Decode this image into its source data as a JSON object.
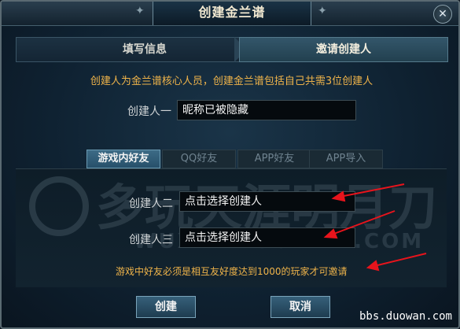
{
  "dialog": {
    "title": "创建金兰谱",
    "close_icon": "close-icon"
  },
  "steps": {
    "step1": "填写信息",
    "step2": "邀请创建人"
  },
  "info_text": "创建人为金兰谱核心人员，创建金兰谱包括自己共需3位创建人",
  "creator1": {
    "label": "创建人一",
    "value": "昵称已被隐藏"
  },
  "tabs": [
    "游戏内好友",
    "QQ好友",
    "APP好友",
    "APP导入"
  ],
  "active_tab": 0,
  "creator2": {
    "label": "创建人二",
    "value": "点击选择创建人"
  },
  "creator3": {
    "label": "创建人三",
    "value": "点击选择创建人"
  },
  "note": "游戏中好友必须是相互友好度达到1000的玩家才可邀请",
  "buttons": {
    "create": "创建",
    "cancel": "取消"
  },
  "watermark": {
    "main": "多玩天涯明月刀",
    "url": "WUXIA.DUOWAN.COM"
  },
  "credit": "bbs.duowan.com",
  "colors": {
    "accent": "#f0b44a",
    "annotation_arrow": "#e8141c"
  }
}
